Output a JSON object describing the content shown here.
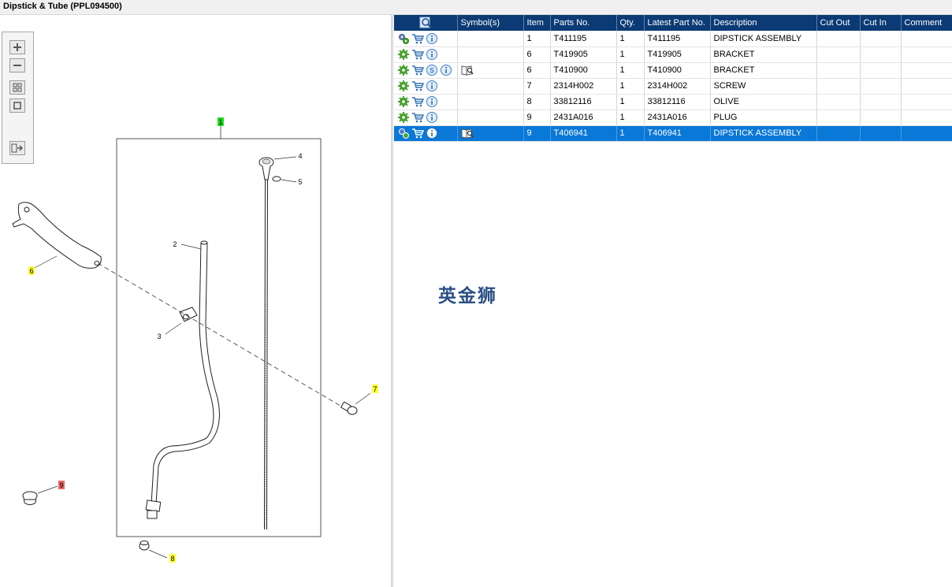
{
  "window": {
    "title": "Dipstick & Tube (PPL094500)"
  },
  "toolbox": {
    "buttons": [
      "zoom-in",
      "zoom-out",
      "fit-page",
      "actual-size",
      "export"
    ]
  },
  "diagram": {
    "callouts": [
      {
        "label": "1",
        "color": "#22dd22"
      },
      {
        "label": "2",
        "color": "none"
      },
      {
        "label": "3",
        "color": "none"
      },
      {
        "label": "4",
        "color": "none"
      },
      {
        "label": "5",
        "color": "none"
      },
      {
        "label": "6",
        "color": "#ffff33"
      },
      {
        "label": "7",
        "color": "#ffff33"
      },
      {
        "label": "8",
        "color": "#ffff33"
      },
      {
        "label": "9",
        "color": "#ee6666"
      }
    ]
  },
  "table": {
    "headers": [
      "",
      "Symbol(s)",
      "Item",
      "Parts No.",
      "Qty.",
      "Latest Part No.",
      "Description",
      "Cut Out",
      "Cut In",
      "Comment"
    ],
    "rows": [
      {
        "icons": [
          "gears",
          "cart",
          "info"
        ],
        "symbol": "",
        "item": "1",
        "part_no": "T411195",
        "qty": "1",
        "latest": "T411195",
        "description": "DIPSTICK ASSEMBLY",
        "cut_out": "",
        "cut_in": "",
        "comment": "",
        "selected": false
      },
      {
        "icons": [
          "gear",
          "cart",
          "info"
        ],
        "symbol": "",
        "item": "6",
        "part_no": "T419905",
        "qty": "1",
        "latest": "T419905",
        "description": "BRACKET",
        "cut_out": "",
        "cut_in": "",
        "comment": "",
        "selected": false
      },
      {
        "icons": [
          "gear",
          "cart",
          "s",
          "info"
        ],
        "symbol": "book",
        "item": "6",
        "part_no": "T410900",
        "qty": "1",
        "latest": "T410900",
        "description": "BRACKET",
        "cut_out": "",
        "cut_in": "",
        "comment": "",
        "selected": false
      },
      {
        "icons": [
          "gear",
          "cart",
          "info"
        ],
        "symbol": "",
        "item": "7",
        "part_no": "2314H002",
        "qty": "1",
        "latest": "2314H002",
        "description": "SCREW",
        "cut_out": "",
        "cut_in": "",
        "comment": "",
        "selected": false
      },
      {
        "icons": [
          "gear",
          "cart",
          "info"
        ],
        "symbol": "",
        "item": "8",
        "part_no": "33812116",
        "qty": "1",
        "latest": "33812116",
        "description": "OLIVE",
        "cut_out": "",
        "cut_in": "",
        "comment": "",
        "selected": false
      },
      {
        "icons": [
          "gear",
          "cart",
          "info"
        ],
        "symbol": "",
        "item": "9",
        "part_no": "2431A016",
        "qty": "1",
        "latest": "2431A016",
        "description": "PLUG",
        "cut_out": "",
        "cut_in": "",
        "comment": "",
        "selected": false
      },
      {
        "icons": [
          "gear-alt",
          "cart",
          "info"
        ],
        "symbol": "book",
        "item": "9",
        "part_no": "T406941",
        "qty": "1",
        "latest": "T406941",
        "description": "DIPSTICK ASSEMBLY",
        "cut_out": "",
        "cut_in": "",
        "comment": "",
        "selected": true
      }
    ]
  },
  "watermark": "英金狮",
  "colors": {
    "header_bg": "#0b3a74",
    "selected_row": "#0a78d7",
    "gear_green": "#4aa52e",
    "cart_blue": "#2f6fb5",
    "info_blue": "#3b7dc4"
  }
}
